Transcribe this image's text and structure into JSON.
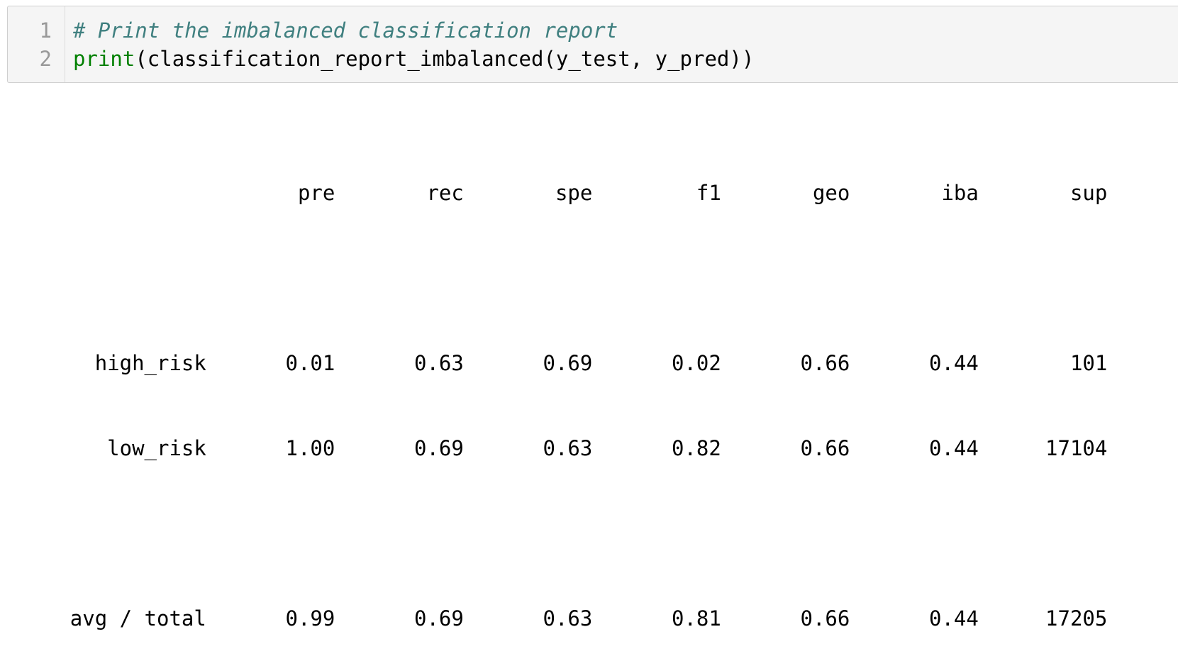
{
  "code_cell": {
    "line_numbers": [
      "1",
      "2"
    ],
    "line1": {
      "comment": "# Print the imbalanced classification report"
    },
    "line2": {
      "builtin": "print",
      "rest": "(classification_report_imbalanced(y_test, y_pred))"
    }
  },
  "output": {
    "header": [
      "pre",
      "rec",
      "spe",
      "f1",
      "geo",
      "iba",
      "sup"
    ],
    "rows": [
      {
        "label": "high_risk",
        "values": [
          "0.01",
          "0.63",
          "0.69",
          "0.02",
          "0.66",
          "0.44",
          "101"
        ]
      },
      {
        "label": "low_risk",
        "values": [
          "1.00",
          "0.69",
          "0.63",
          "0.82",
          "0.66",
          "0.44",
          "17104"
        ]
      }
    ],
    "total": {
      "label": "avg / total",
      "values": [
        "0.99",
        "0.69",
        "0.63",
        "0.81",
        "0.66",
        "0.44",
        "17205"
      ]
    }
  }
}
